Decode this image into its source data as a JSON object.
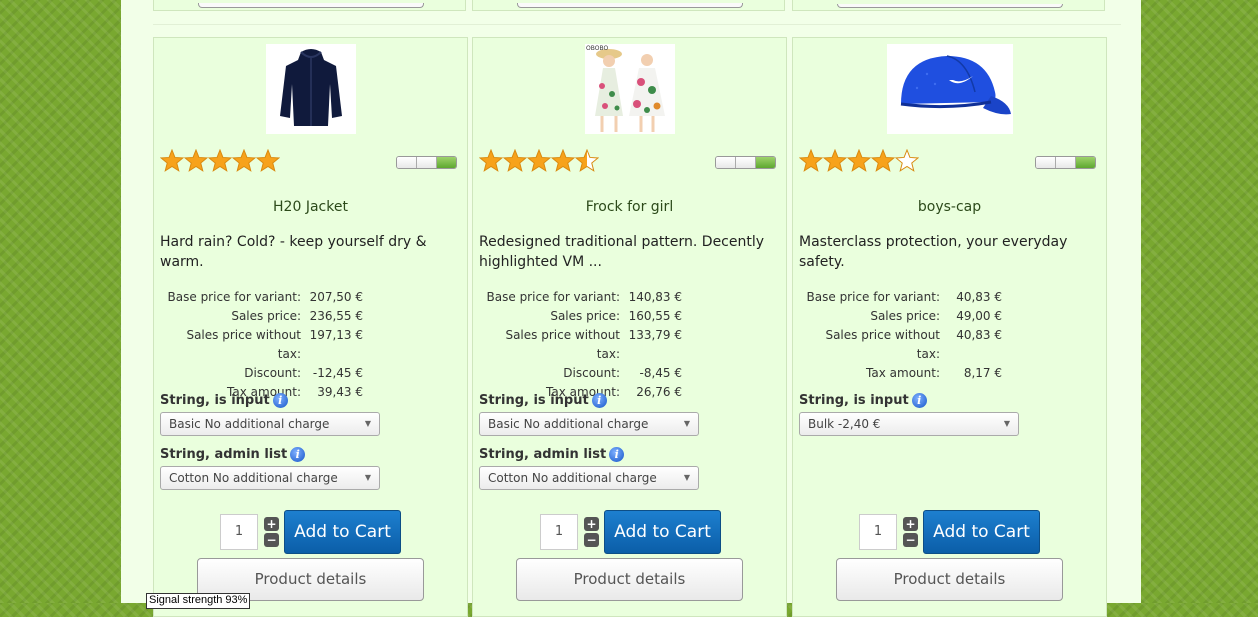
{
  "products": [
    {
      "name": "H20 Jacket",
      "description": "Hard rain? Cold? - keep yourself dry & warm.",
      "rating": 5,
      "prices": [
        {
          "label": "Base price for variant:",
          "value": "207,50 €"
        },
        {
          "label": "Sales price:",
          "value": "236,55 €"
        },
        {
          "label": "Sales price without tax:",
          "value": "197,13 €"
        },
        {
          "label": "Discount:",
          "value": "-12,45 €"
        },
        {
          "label": "Tax amount:",
          "value": "39,43 €"
        }
      ],
      "field1_label": "String, is input",
      "field1_value": "Basic No additional charge",
      "field2_label": "String, admin list",
      "field2_value": "Cotton No additional charge",
      "quantity": "1",
      "add_to_cart": "Add to Cart",
      "details": "Product details"
    },
    {
      "name": "Frock for girl",
      "description": "Redesigned traditional pattern. Decently highlighted VM ...",
      "rating": 4.5,
      "prices": [
        {
          "label": "Base price for variant:",
          "value": "140,83 €"
        },
        {
          "label": "Sales price:",
          "value": "160,55 €"
        },
        {
          "label": "Sales price without tax:",
          "value": "133,79 €"
        },
        {
          "label": "Discount:",
          "value": "-8,45 €"
        },
        {
          "label": "Tax amount:",
          "value": "26,76 €"
        }
      ],
      "field1_label": "String, is input",
      "field1_value": "Basic No additional charge",
      "field2_label": "String, admin list",
      "field2_value": "Cotton No additional charge",
      "quantity": "1",
      "add_to_cart": "Add to Cart",
      "details": "Product details"
    },
    {
      "name": "boys-cap",
      "description": "Masterclass protection, your everyday safety.",
      "rating": 4,
      "prices": [
        {
          "label": "Base price for variant:",
          "value": "40,83 €"
        },
        {
          "label": "Sales price:",
          "value": "49,00 €"
        },
        {
          "label": "Sales price without tax:",
          "value": "40,83 €"
        },
        {
          "label": "Tax amount:",
          "value": "8,17 €"
        }
      ],
      "field1_label": "String, is input",
      "field1_value": "Bulk -2,40 €",
      "quantity": "1",
      "add_to_cart": "Add to Cart",
      "details": "Product details"
    }
  ],
  "tooltip": "Signal strength 93%",
  "colors": {
    "accent": "#0b5ea8",
    "card_background": "#eaffdd",
    "page_background": "#79a830",
    "star": "#f7a21b"
  }
}
